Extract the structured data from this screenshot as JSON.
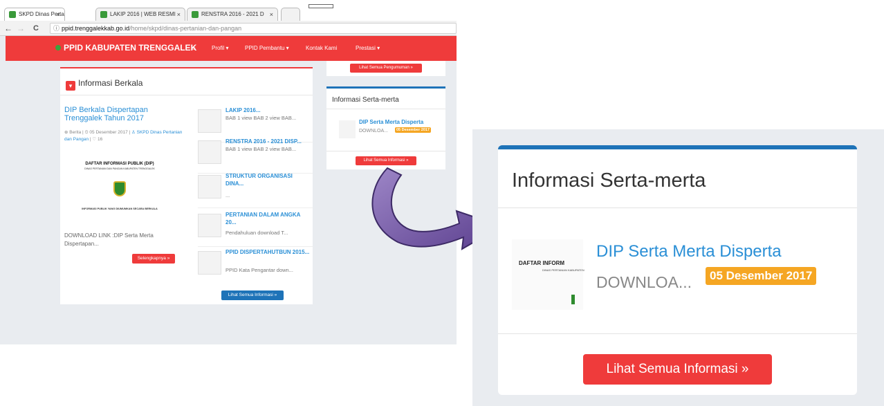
{
  "browser": {
    "tabs": [
      {
        "label": "SKPD Dinas Pertanian da",
        "close": "×"
      },
      {
        "label": "LAKIP 2016 | WEB RESMI",
        "close": "×"
      },
      {
        "label": "RENSTRA 2016 - 2021 D",
        "close": "×"
      }
    ],
    "url_host": "ppid.trenggalekkab.go.id",
    "url_path": "/home/skpd/dinas-pertanian-dan-pangan",
    "nav_back": "←",
    "nav_forward": "→",
    "nav_reload": "C",
    "url_info": "ⓘ"
  },
  "navbar": {
    "brand": "PPID KABUPATEN TRENGGALEK",
    "home": "⌂",
    "items": [
      "Profil ▾",
      "PPID Pembantu ▾",
      "Kontak Kami",
      "Prestasi ▾"
    ]
  },
  "informasi_berkala": {
    "icon": "▾",
    "heading": "Informasi Berkala",
    "featured": {
      "title": "DIP Berkala Dispertapan Trenggalek Tahun 2017",
      "meta_prefix": "⊕ Berita | ⏲ 05 Desember 2017 | ",
      "meta_author": "♙ SKPD Dinas Pertanian dan Pangan",
      "meta_suffix": " | ♡ 16",
      "image_title": "DAFTAR INFORMASI PUBLIK (DIP)",
      "image_subtitle": "DINAS PERTANIAN DAN PANGAN KABUPATEN TRENGGALEK",
      "image_footer": "INFORMASI PUBLIK YANG DIUMUMKAN SECARA BERKALA",
      "description": "DOWNLOAD LINK :DIP Serta Merta Dispertapan...",
      "button": "Selengkapnya »"
    },
    "list": [
      {
        "title": "LAKIP 2016...",
        "desc": "BAB 1 view BAB 2 view BAB..."
      },
      {
        "title": "RENSTRA 2016 - 2021 DISP...",
        "desc": "BAB 1 view BAB 2 view BAB..."
      },
      {
        "title": "STRUKTUR ORGANISASI DINA...",
        "desc": "..."
      },
      {
        "title": "PERTANIAN DALAM ANGKA 20...",
        "desc": "Pendahuluan download T..."
      },
      {
        "title": "PPID DISPERTAHUTBUN 2015...",
        "desc": "PPID Kata Pengantar down..."
      }
    ],
    "list_button": "Lihat Semua Informasi »"
  },
  "pengumuman_button": "Lihat Semua Pengumuman »",
  "serta_merta": {
    "heading": "Informasi Serta-merta",
    "item_title": "DIP Serta Merta Disperta",
    "item_desc": "DOWNLOA...",
    "item_date": "05 Desember 2017",
    "thumb_line1": "DAFTAR INFORM",
    "thumb_line2": "DINAS PERTANIAN KABUPATEN",
    "button": "Lihat Semua Informasi »"
  },
  "colors": {
    "navbar_red": "#ef3b3b",
    "link_blue": "#2a8fd6",
    "panel_blue": "#1e73b8",
    "date_orange": "#f5a623",
    "arrow_purple": "#7b5ea7"
  }
}
